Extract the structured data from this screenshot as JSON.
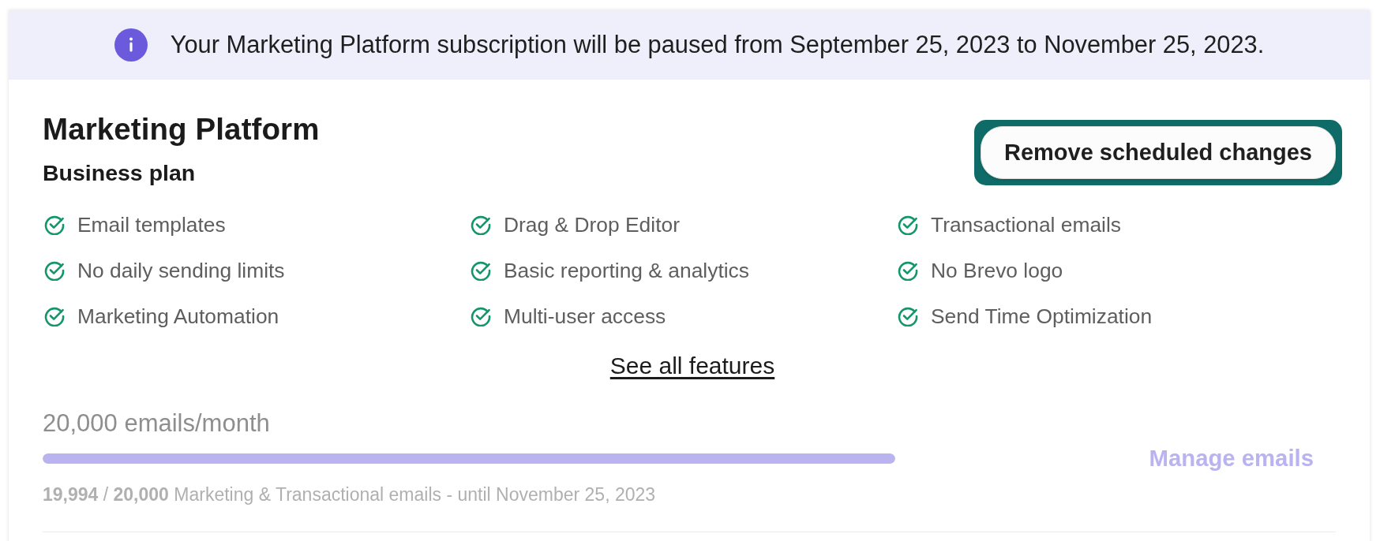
{
  "notice": {
    "text": "Your Marketing Platform subscription will be paused from September 25, 2023 to November 25, 2023."
  },
  "plan": {
    "title": "Marketing Platform",
    "name": "Business plan",
    "action": {
      "label": "Remove scheduled changes",
      "focused": true
    }
  },
  "features": [
    "Email templates",
    "Drag & Drop Editor",
    "Transactional emails",
    "No daily sending limits",
    "Basic reporting & analytics",
    "No Brevo logo",
    "Marketing Automation",
    "Multi-user access",
    "Send Time Optimization"
  ],
  "see_all_link": "See all features",
  "usage": {
    "quota": "20,000 emails/month",
    "level": 1,
    "manage_link": {
      "label": "Manage emails",
      "disabled": true
    },
    "detail": "**19,994** / **20,000** Marketing & Transactional emails - until November 25, 2023"
  }
}
